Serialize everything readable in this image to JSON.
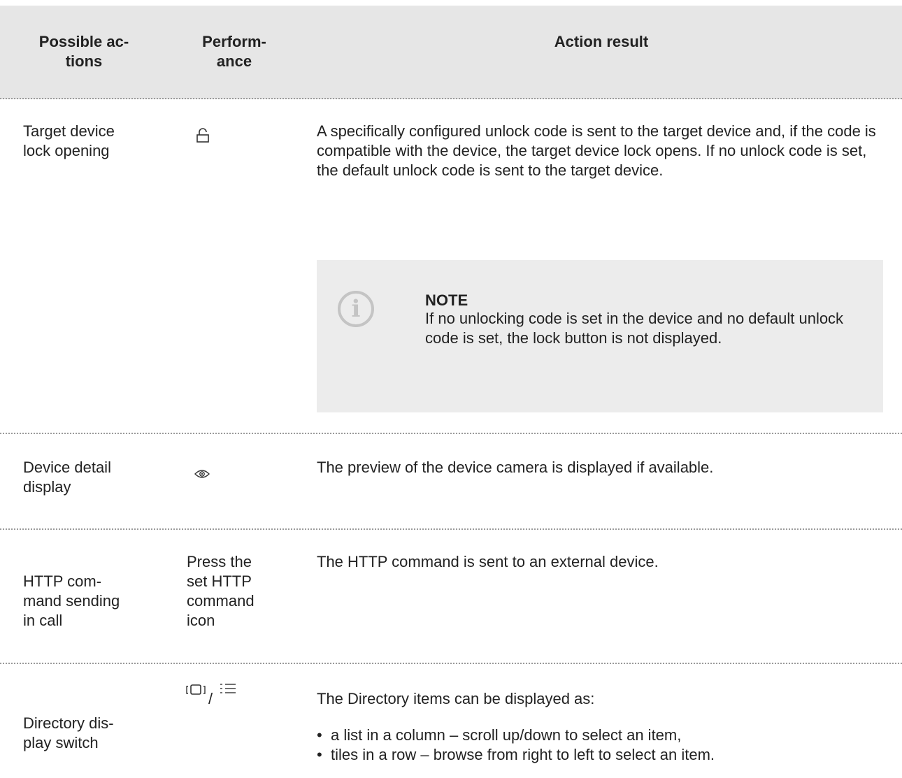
{
  "header": {
    "col1": "Possible ac-\ntions",
    "col2": "Perform-\nance",
    "col3": "Action result"
  },
  "rows": [
    {
      "action": "Target device\nlock opening",
      "performance_icon": "unlock-icon",
      "result": "A specifically configured unlock code is sent to the target device and, if the code is compatible with the device, the target device lock opens. If no unlock code is set, the default unlock code is sent to the target device.",
      "note": {
        "icon": "info-icon",
        "title": "NOTE",
        "text": "If no unlocking code is set in the device and no default unlock code is set, the lock button is not displayed."
      }
    },
    {
      "action": "Device detail\ndisplay",
      "performance_icon": "eye-icon",
      "result": "The preview of the device camera is displayed if available."
    },
    {
      "action": "HTTP com-\nmand sending\nin call",
      "performance": "Press the\nset HTTP\ncommand\nicon",
      "result": "The HTTP command is sent to an external device."
    },
    {
      "action": "Directory dis-\nplay switch",
      "performance_icons": [
        "tiles-view-icon",
        "list-view-icon"
      ],
      "performance_separator": "/",
      "result": "The Directory items can be displayed as:",
      "bullets": [
        "a list in a column – scroll up/down to select an item,",
        "tiles in a row – browse from right to left to select an item."
      ]
    }
  ]
}
